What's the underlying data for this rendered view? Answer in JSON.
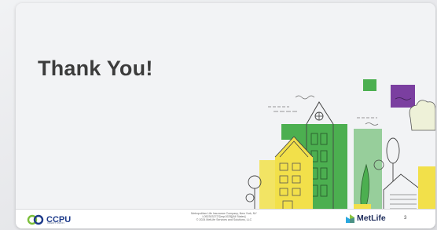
{
  "slide": {
    "title": "Thank You!",
    "slide_number": "3"
  },
  "footer": {
    "ccpu_logo_text": "CCPU",
    "ccpu_logo_subtext": "CREDIT UNION",
    "disclaimer_line1": "Metropolitan Life Insurance Company, New York, NY",
    "disclaimer_line2": "L0523032727[exp1025][All States]",
    "disclaimer_line3": "© 2024 MetLife Services and Solutions, LLC",
    "metlife_logo_text": "MetLife"
  },
  "colors": {
    "green": "#4caf50",
    "dark_green": "#3d9a46",
    "yellow": "#f2e04a",
    "purple": "#7b3fa0",
    "navy": "#1f2d5c",
    "ccpu_blue": "#1d3a8a",
    "ccpu_green": "#7cbf3a"
  },
  "icons": [
    "ccpu-logo-icon",
    "metlife-logo-icon",
    "city-houses-illustration"
  ]
}
